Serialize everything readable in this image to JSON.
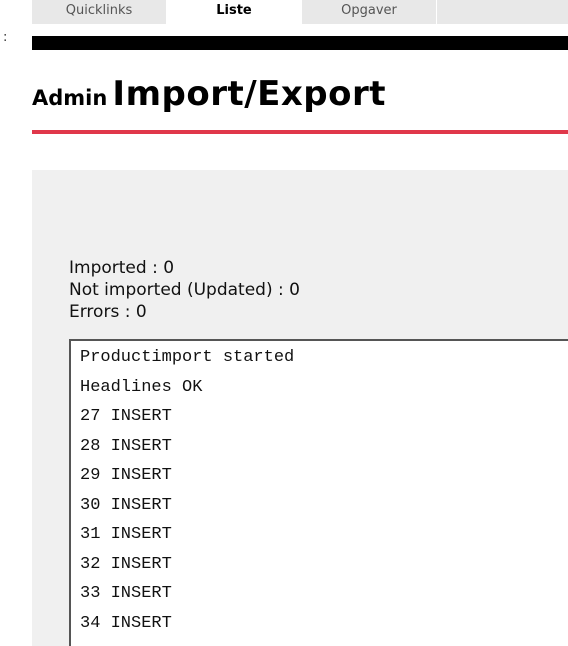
{
  "tabs": [
    {
      "label": "Quicklinks",
      "active": false
    },
    {
      "label": "Liste",
      "active": true
    },
    {
      "label": "Opgaver",
      "active": false
    },
    {
      "label": "",
      "active": false
    }
  ],
  "edge_mark": ":",
  "header": {
    "title_prefix": "Admin",
    "title_main": "Import/Export"
  },
  "stats": {
    "imported": "Imported : 0",
    "not_imported": "Not imported (Updated) : 0",
    "errors": "Errors : 0"
  },
  "log": [
    "Productimport started",
    "Headlines OK",
    "27 INSERT",
    "28 INSERT",
    "29 INSERT",
    "30 INSERT",
    "31 INSERT",
    "32 INSERT",
    "33 INSERT",
    "34 INSERT"
  ],
  "colors": {
    "accent_line": "#e0374a",
    "top_bar": "#000000",
    "panel_bg": "#f0f0f0"
  }
}
